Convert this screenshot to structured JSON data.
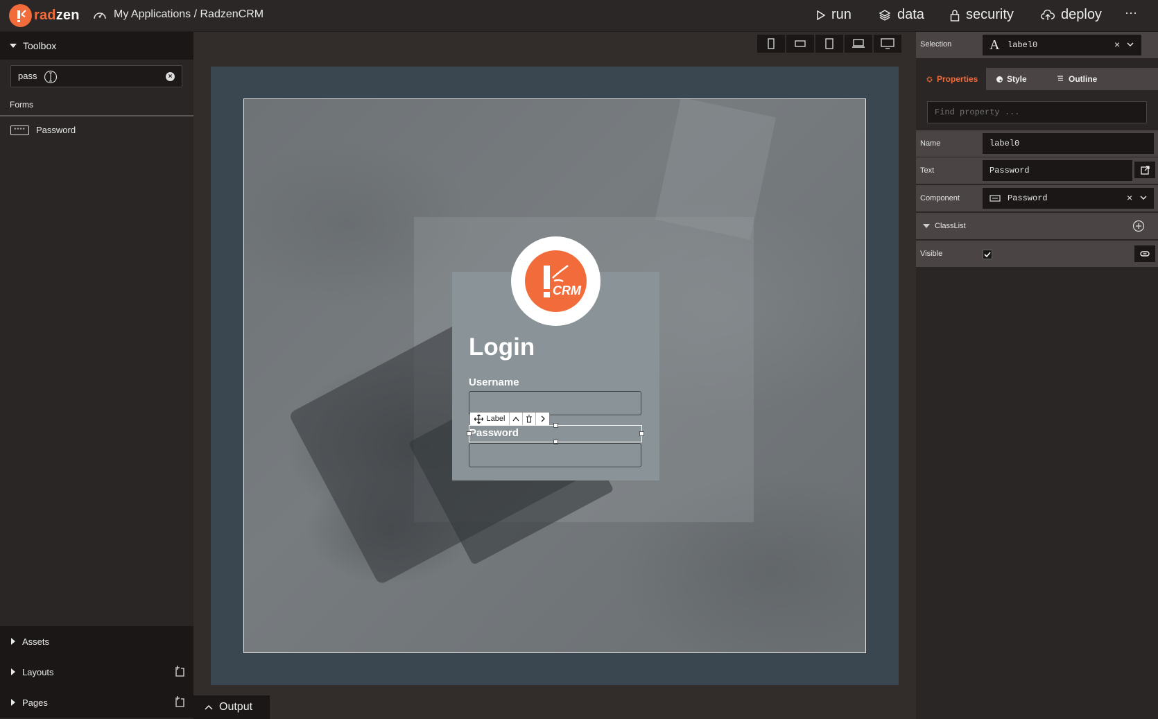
{
  "header": {
    "brand_prefix": "rad",
    "brand_suffix": "zen",
    "breadcrumb": "My Applications / RadzenCRM",
    "nav": [
      {
        "label": "run",
        "icon": "play-icon"
      },
      {
        "label": "data",
        "icon": "layers-icon"
      },
      {
        "label": "security",
        "icon": "lock-icon"
      },
      {
        "label": "deploy",
        "icon": "cloud-upload-icon"
      }
    ],
    "more": "···"
  },
  "toolbox": {
    "title": "Toolbox",
    "search_value": "pass",
    "category": "Forms",
    "items": [
      {
        "label": "Password",
        "icon": "password-field-icon"
      }
    ],
    "pw_icon_text": "****"
  },
  "bottom_sections": {
    "assets": "Assets",
    "layouts": "Layouts",
    "pages": "Pages"
  },
  "output_tab": "Output",
  "canvas": {
    "login_title": "Login",
    "username_label": "Username",
    "password_label": "Password",
    "logo_text": "CRM",
    "selection_toolbar_label": "Label"
  },
  "properties": {
    "selection_label": "Selection",
    "selection_value": "label0",
    "selection_icon_text": "A",
    "tabs": [
      "Properties",
      "Style",
      "Outline"
    ],
    "find_placeholder": "Find property ...",
    "rows": {
      "name_label": "Name",
      "name_value": "label0",
      "text_label": "Text",
      "text_value": "Password",
      "component_label": "Component",
      "component_value": "Password",
      "classlist_label": "ClassList",
      "visible_label": "Visible"
    },
    "clear_symbol": "×"
  },
  "colors": {
    "accent": "#f26b3a",
    "panel_bg": "#2a2625",
    "stage_bg": "#3a4750"
  }
}
